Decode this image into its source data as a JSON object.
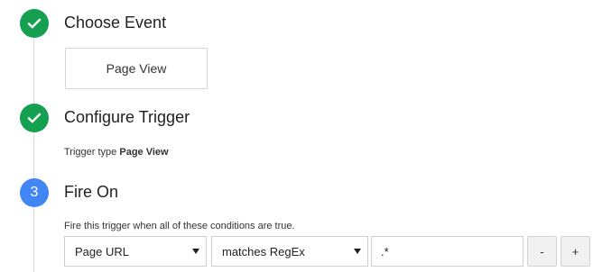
{
  "steps": [
    {
      "status": "complete",
      "icon": "check-icon",
      "title": "Choose Event"
    },
    {
      "status": "complete",
      "icon": "check-icon",
      "title": "Configure Trigger"
    },
    {
      "status": "active",
      "number": "3",
      "title": "Fire On"
    }
  ],
  "event_selection": {
    "label": "Page View"
  },
  "trigger_type": {
    "prefix": "Trigger type",
    "value": "Page View"
  },
  "fire_on": {
    "description": "Fire this trigger when all of these conditions are true.",
    "condition": {
      "variable": "Page URL",
      "operator": "matches RegEx",
      "value": ".*"
    },
    "remove_label": "-",
    "add_label": "+"
  },
  "colors": {
    "complete": "#14a050",
    "active": "#4285f4",
    "timeline": "#d9d9d9"
  }
}
